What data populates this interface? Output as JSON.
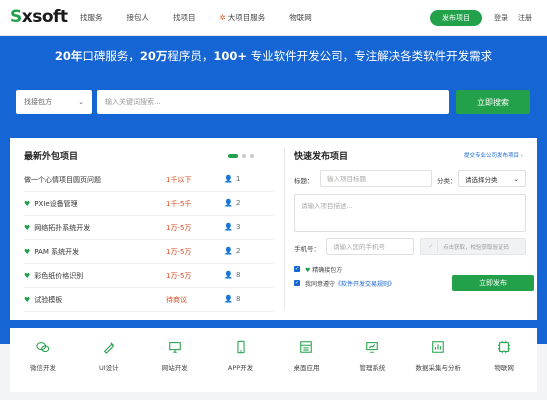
{
  "header": {
    "logo_prefix": "S",
    "logo_text": "xsoft",
    "nav": [
      "找服务",
      "接包人",
      "找项目",
      "大项目服务",
      "物联网"
    ],
    "publish_label": "发布项目",
    "login": "登录",
    "register": "注册"
  },
  "hero": {
    "tag_num1": "20年",
    "tag_text1": "口碑服务，",
    "tag_num2": "20万",
    "tag_text2": "程序员，",
    "tag_num3": "100+",
    "tag_text3": "专业软件开发公司，专注解决各类软件开发需求",
    "search_select": "找接包方",
    "search_placeholder": "输入关键词搜索...",
    "search_button": "立即搜索"
  },
  "latest": {
    "title": "最新外包项目",
    "projects": [
      {
        "title": "做一个心情项目圆页问题",
        "budget": "1千以下",
        "count": "1",
        "verified": false
      },
      {
        "title": "PXIe设备管理",
        "budget": "1千-5千",
        "count": "2",
        "verified": true
      },
      {
        "title": "网络拓扑系统开发",
        "budget": "1万-5万",
        "count": "3",
        "verified": true
      },
      {
        "title": "PAM 系统开发",
        "budget": "1万-5万",
        "count": "2",
        "verified": true
      },
      {
        "title": "彩色纸价格识别",
        "budget": "1万-5万",
        "count": "8",
        "verified": true
      },
      {
        "title": "试验模板",
        "budget": "待商议",
        "count": "8",
        "verified": true
      }
    ]
  },
  "quick": {
    "title": "快速发布项目",
    "help_link": "提交专业公司发布项目 ›",
    "title_label": "标题：",
    "title_placeholder": "输入项目标题",
    "category_label": "分类：",
    "category_value": "请选择分类",
    "desc_placeholder": "请输入项目描述...",
    "phone_label": "手机号：",
    "phone_placeholder": "请输入您的手机号",
    "code_hint": "点击获取，校验获取验证码",
    "agree1_prefix": "✓",
    "agree1": "精确接包方",
    "agree2_text": "我同意遵守",
    "agree2_link": "《软件开发交易规则》",
    "submit_label": "立即发布"
  },
  "categories": [
    "微信开发",
    "UI设计",
    "网站开发",
    "APP开发",
    "桌面应用",
    "管理系统",
    "数据采集与分析",
    "物联网"
  ],
  "colors": {
    "brand_blue": "#1665d4",
    "brand_green": "#22a04a",
    "price_red": "#d9481c"
  }
}
